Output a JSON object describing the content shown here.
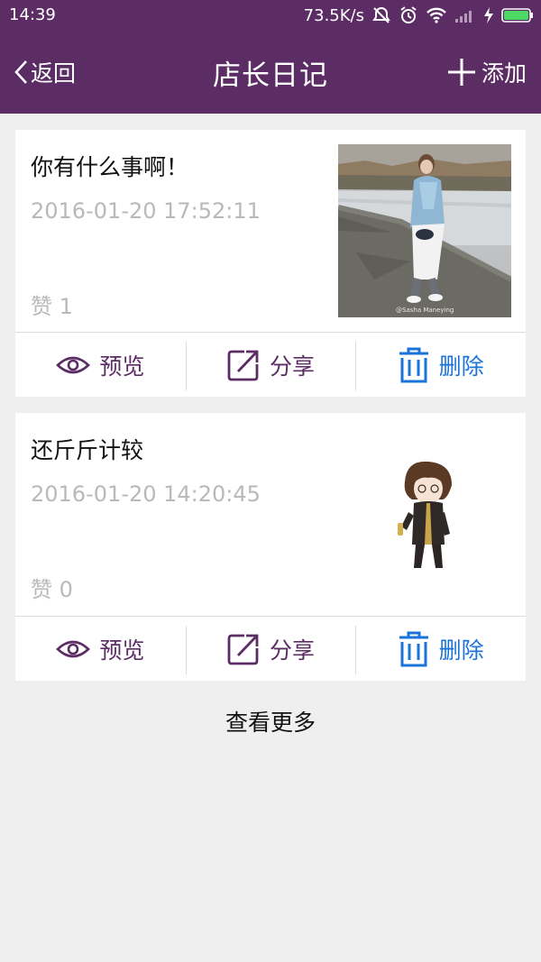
{
  "status_bar": {
    "time": "14:39",
    "speed": "73.5K/s",
    "icons": [
      "mute-icon",
      "alarm-icon",
      "wifi-icon",
      "signal-icon",
      "charging-icon",
      "battery-icon"
    ]
  },
  "nav": {
    "back_label": "返回",
    "title": "店长日记",
    "add_label": "添加"
  },
  "colors": {
    "header_bg": "#5c2d64",
    "accent_purple": "#5c2d64",
    "accent_blue": "#1a73d9",
    "muted_text": "#b9b9b9",
    "page_bg": "#efefef"
  },
  "diaries": [
    {
      "title": "你有什么事啊！",
      "date": "2016-01-20 17:52:11",
      "likes": "赞 1",
      "image": "photo-of-woman-by-river",
      "image_watermark": "@Sasha Maneying 李福娜"
    },
    {
      "title": "还斤斤计较",
      "date": "2016-01-20 14:20:45",
      "likes": "赞 0",
      "image": "anime-boy-sticker"
    }
  ],
  "actions": {
    "preview_label": "预览",
    "share_label": "分享",
    "delete_label": "删除"
  },
  "load_more_label": "查看更多"
}
